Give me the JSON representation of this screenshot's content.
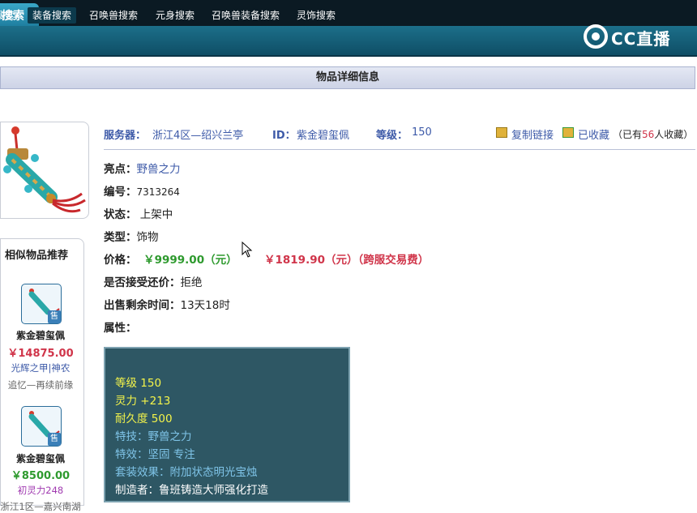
{
  "header": {
    "active_tab": "搜索",
    "nav": [
      "搜索",
      "装备搜索",
      "召唤兽搜索",
      "元身搜索",
      "召唤兽装备搜索",
      "灵饰搜索"
    ],
    "logo_text": "CC直播"
  },
  "title": "物品详细信息",
  "info": {
    "server_label": "服务器：",
    "server_value": "浙江4区—绍兴兰亭",
    "id_label": "ID：",
    "id_value": "紫金碧玺佩",
    "level_label": "等级：",
    "level_value": "150",
    "copy_link": "复制链接",
    "collected": "已收藏",
    "collect_count_prefix": "（已有",
    "collect_count": "56",
    "collect_count_suffix": "人收藏）"
  },
  "details": {
    "highlight_label": "亮点：",
    "highlight_value": "野兽之力",
    "number_label": "编号：",
    "number_value": "7313264",
    "status_label": "状态：",
    "status_value": "上架中",
    "type_label": "类型：",
    "type_value": "饰物",
    "price_label": "价格：",
    "price_value": "￥9999.00（元）",
    "fee_value": "￥1819.90（元）（跨服交易费）",
    "counter_label": "是否接受还价：",
    "counter_value": "拒绝",
    "remaining_label": "出售剩余时间：",
    "remaining_value": "13天18时",
    "attr_label": "属性："
  },
  "attributes": {
    "level": "等级 150",
    "spirit": "灵力 +213",
    "durability": "耐久度 500",
    "skill": "特技：野兽之力",
    "effect": "特效：坚固 专注",
    "set": "套装效果：附加状态明光宝烛",
    "maker": "制造者：鲁班铸造大师强化打造"
  },
  "recommend": {
    "heading": "相似物品推荐",
    "items": [
      {
        "name": "紫金碧玺佩",
        "price": "￥14875.00",
        "sub1": "光辉之甲|神农",
        "sub2": "追忆—再续前缘",
        "tag": "售"
      },
      {
        "name": "紫金碧玺佩",
        "price": "￥8500.00",
        "sub1": "初灵力248",
        "sub2": "浙江1区—嘉兴南湖",
        "tag": "售"
      }
    ]
  },
  "colors": {
    "nav_bg": "#1c6f8a",
    "link_blue": "#3d5aa8",
    "price_green": "#2e9a2e",
    "price_red": "#d0354a",
    "attr_yellow": "#f4f44a",
    "attr_blue": "#7fc4e8",
    "attr_white": "#ffffff"
  }
}
